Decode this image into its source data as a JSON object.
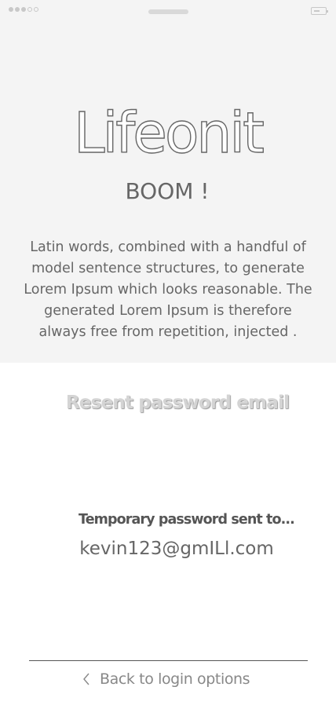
{
  "status_bar": {
    "signal_dots": [
      "filled",
      "filled",
      "filled",
      "empty",
      "empty"
    ],
    "battery_icon": "battery-icon"
  },
  "hero": {
    "logo": "Lifeonit",
    "tagline": "BOOM !",
    "description": "Latin words, combined with a handful of model sentence structures, to generate Lorem Ipsum which looks reasonable. The generated Lorem Ipsum is therefore always free from repetition, injected ."
  },
  "main": {
    "heading": "Resent password email",
    "temp_label": "Temporary password sent to...",
    "email": "kevin123@gmILl.com"
  },
  "footer": {
    "back_icon": "chevron-left-icon",
    "back_label": "Back to login options"
  },
  "colors": {
    "hero_bg": "#f4f4f4",
    "text": "#666666",
    "link": "#888888"
  }
}
